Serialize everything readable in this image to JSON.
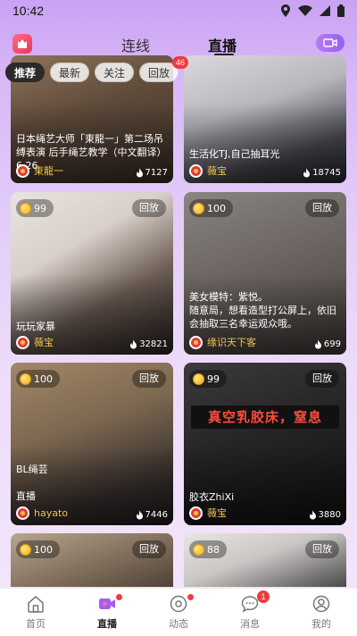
{
  "status_bar": {
    "time": "10:42"
  },
  "top_nav": {
    "tabs": [
      {
        "label": "连线",
        "active": false
      },
      {
        "label": "直播",
        "active": true
      }
    ]
  },
  "filters": {
    "chips": [
      {
        "label": "推荐",
        "active": true
      },
      {
        "label": "最新",
        "active": false
      },
      {
        "label": "关注",
        "active": false
      },
      {
        "label": "回放",
        "active": false,
        "count": "46"
      }
    ]
  },
  "cards": [
    {
      "title": "日本绳艺大师「東龍一」第二场吊缚表演 后手绳艺教学（中文翻译）6.26",
      "username": "東龍一",
      "views": "7127",
      "coin": "",
      "badge": ""
    },
    {
      "title": "生活化TJ,自己抽耳光",
      "username": "薇宝",
      "views": "18745",
      "coin": "",
      "badge": ""
    },
    {
      "title": "玩玩家暴",
      "username": "薇宝",
      "views": "32821",
      "coin": "99",
      "badge": "回放"
    },
    {
      "title": "美女模特：紫悦。\n随意局，想看造型打公屏上，依旧会抽取三名幸运观众哦。",
      "username": "缘识天下客",
      "views": "699",
      "coin": "100",
      "badge": "回放"
    },
    {
      "title": "BL绳芸\n\n直播",
      "username": "hayato",
      "views": "7446",
      "coin": "100",
      "badge": "回放"
    },
    {
      "title": "胶衣ZhiXi",
      "username": "薇宝",
      "views": "3880",
      "coin": "99",
      "badge": "回放",
      "banner": "真空乳胶床，窒息"
    },
    {
      "title": "",
      "username": "",
      "views": "",
      "coin": "100",
      "badge": "回放"
    },
    {
      "title": "",
      "username": "",
      "views": "",
      "coin": "88",
      "badge": "回放"
    }
  ],
  "bottom_tabs": [
    {
      "label": "首页",
      "icon": "home-icon",
      "active": false
    },
    {
      "label": "直播",
      "icon": "live-video-icon",
      "active": true
    },
    {
      "label": "动态",
      "icon": "moments-icon",
      "active": false
    },
    {
      "label": "消息",
      "icon": "message-icon",
      "active": false,
      "count": "1"
    },
    {
      "label": "我的",
      "icon": "profile-icon",
      "active": false
    }
  ],
  "colors": {
    "accent": "#b57cf5",
    "badge_red": "#ef3b3b",
    "username_gold": "#f1c44b"
  }
}
